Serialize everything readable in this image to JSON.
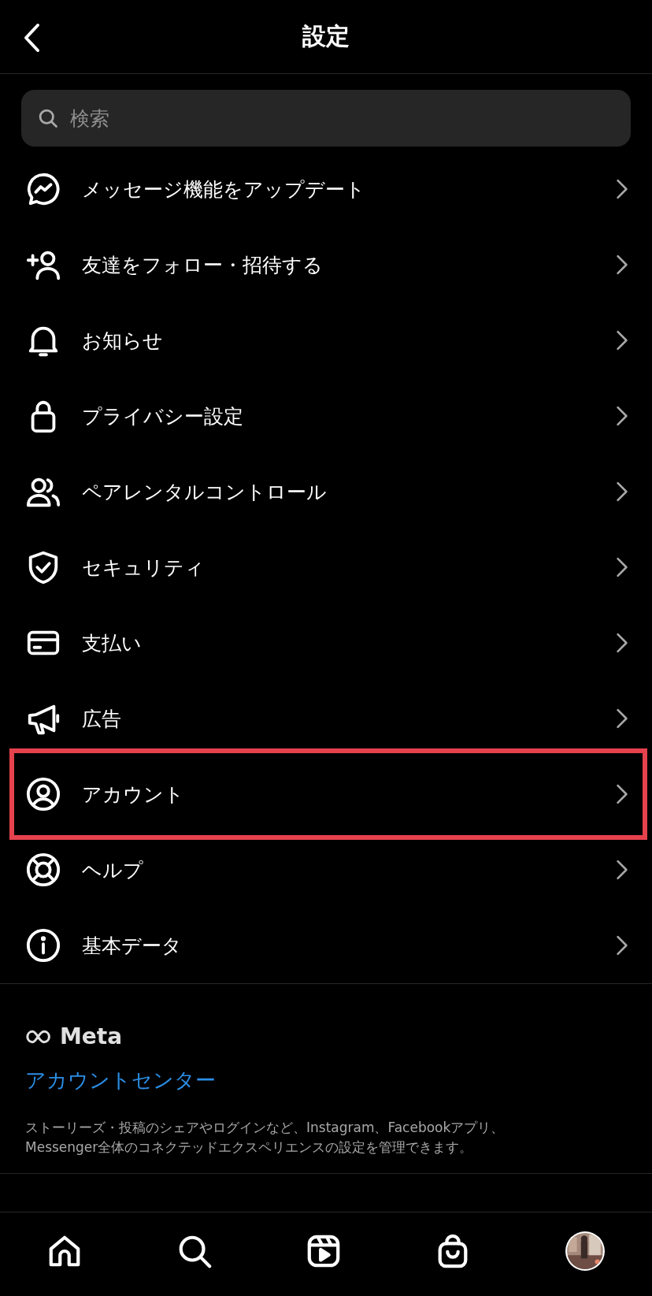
{
  "header": {
    "title": "設定"
  },
  "search": {
    "placeholder": "検索"
  },
  "items": [
    {
      "label": "メッセージ機能をアップデート",
      "highlighted": false
    },
    {
      "label": "友達をフォロー・招待する",
      "highlighted": false
    },
    {
      "label": "お知らせ",
      "highlighted": false
    },
    {
      "label": "プライバシー設定",
      "highlighted": false
    },
    {
      "label": "ペアレンタルコントロール",
      "highlighted": false
    },
    {
      "label": "セキュリティ",
      "highlighted": false
    },
    {
      "label": "支払い",
      "highlighted": false
    },
    {
      "label": "広告",
      "highlighted": false
    },
    {
      "label": "アカウント",
      "highlighted": true
    },
    {
      "label": "ヘルプ",
      "highlighted": false
    },
    {
      "label": "基本データ",
      "highlighted": false
    }
  ],
  "meta": {
    "logo": "Meta",
    "link": "アカウントセンター",
    "description": "ストーリーズ・投稿のシェアやログインなど、Instagram、Facebookアプリ、Messenger全体のコネクテッドエクスペリエンスの設定を管理できます。"
  }
}
